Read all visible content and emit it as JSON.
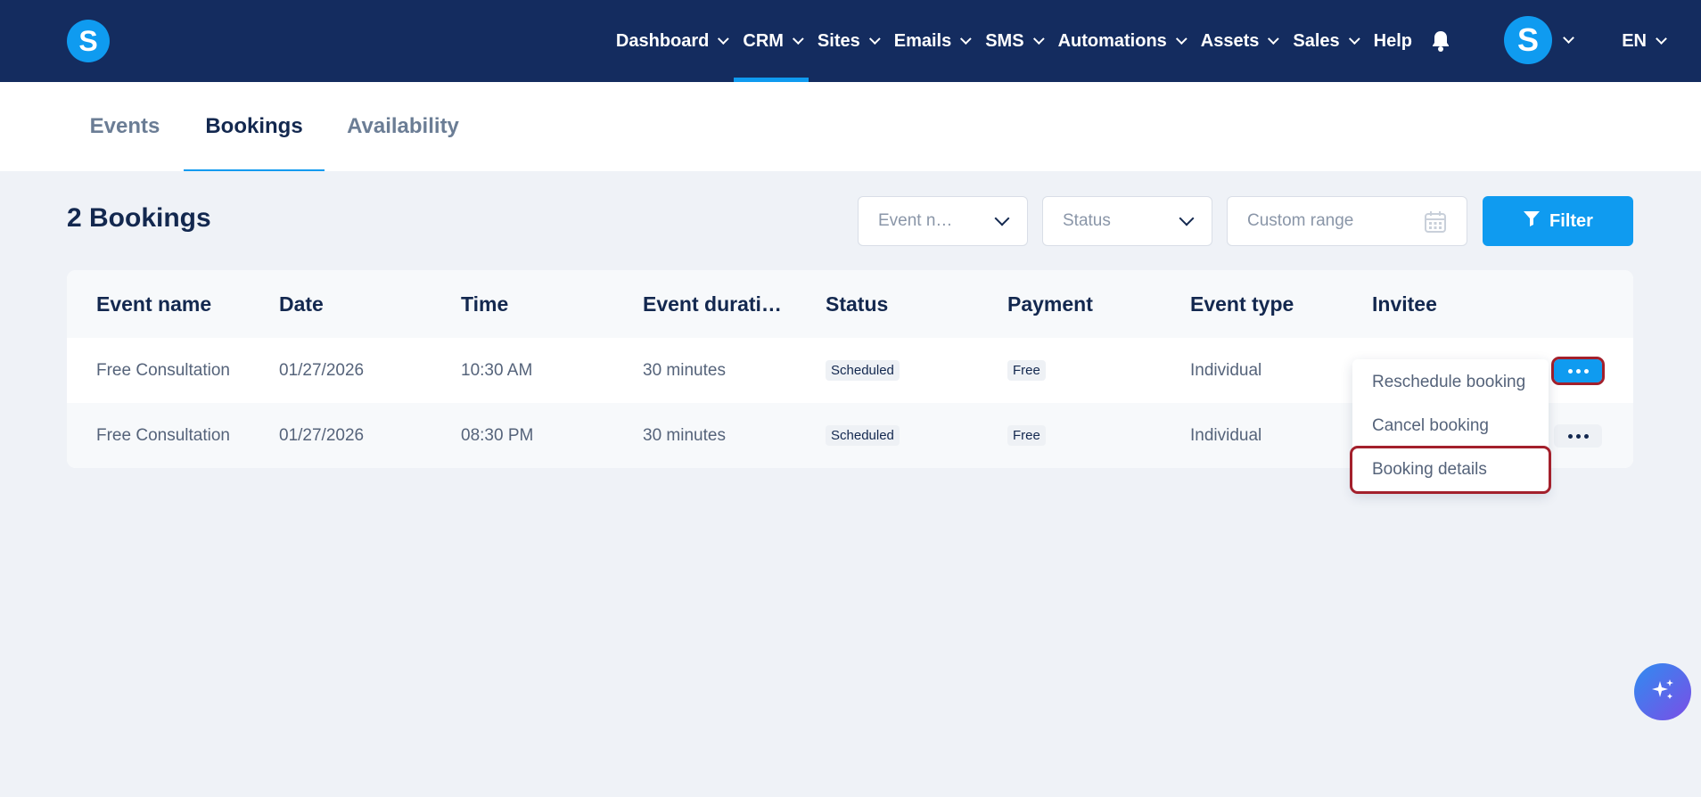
{
  "nav": {
    "items": [
      {
        "label": "Dashboard"
      },
      {
        "label": "CRM"
      },
      {
        "label": "Sites"
      },
      {
        "label": "Emails"
      },
      {
        "label": "SMS"
      },
      {
        "label": "Automations"
      },
      {
        "label": "Assets"
      },
      {
        "label": "Sales"
      },
      {
        "label": "Help"
      }
    ],
    "logo_letter": "S",
    "avatar_letter": "S",
    "language": "EN"
  },
  "tabs": [
    {
      "label": "Events"
    },
    {
      "label": "Bookings"
    },
    {
      "label": "Availability"
    }
  ],
  "page": {
    "title": "2 Bookings"
  },
  "filters": {
    "event_name_placeholder": "Event n…",
    "status_placeholder": "Status",
    "date_range_placeholder": "Custom range",
    "filter_label": "Filter"
  },
  "table": {
    "columns": [
      "Event name",
      "Date",
      "Time",
      "Event durati…",
      "Status",
      "Payment",
      "Event type",
      "Invitee"
    ],
    "rows": [
      {
        "event_name": "Free Consultation",
        "date": "01/27/2026",
        "time": "10:30 AM",
        "duration": "30 minutes",
        "status": "Scheduled",
        "payment": "Free",
        "event_type": "Individual",
        "invitee": ""
      },
      {
        "event_name": "Free Consultation",
        "date": "01/27/2026",
        "time": "08:30 PM",
        "duration": "30 minutes",
        "status": "Scheduled",
        "payment": "Free",
        "event_type": "Individual",
        "invitee": ""
      }
    ]
  },
  "row_menu": {
    "items": [
      {
        "label": "Reschedule booking"
      },
      {
        "label": "Cancel booking"
      },
      {
        "label": "Booking details"
      }
    ]
  },
  "colors": {
    "nav_bg": "#142c5f",
    "accent": "#0f9bf0",
    "highlight_outline": "#a3202c"
  }
}
